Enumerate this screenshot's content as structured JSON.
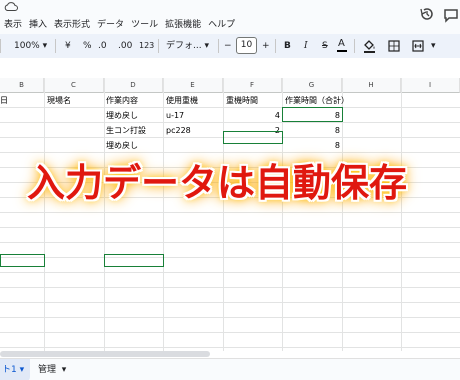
{
  "menu": [
    "表示",
    "挿入",
    "表示形式",
    "データ",
    "ツール",
    "拡張機能",
    "ヘルプ"
  ],
  "toolbar": {
    "zoom": "100%",
    "yen": "¥",
    "percent": "%",
    "dec_less": ".0",
    "dec_more": ".00",
    "num_format": "123",
    "font": "デフォ...",
    "minus": "−",
    "font_size": "10",
    "plus": "+",
    "bold": "B",
    "italic": "I",
    "strike": "S",
    "text_color": "A"
  },
  "columns": [
    "B",
    "C",
    "D",
    "E",
    "F",
    "G",
    "H",
    "I"
  ],
  "sheet": {
    "header_row": {
      "b": "日",
      "c": "現場名",
      "d": "作業内容",
      "e": "使用重機",
      "f": "重機時間",
      "g": "作業時間（合計）"
    },
    "rows": [
      {
        "d": "埋め戻し",
        "e": "u-17",
        "f": "4",
        "g": "8"
      },
      {
        "d": "生コン打設",
        "e": "pc228",
        "f": "2",
        "g": "8"
      },
      {
        "d": "埋め戻し",
        "e": "",
        "f": "",
        "g": "8"
      }
    ]
  },
  "overlay": {
    "headline": "入力データは自動保存"
  },
  "tabs": {
    "active": "ト1",
    "second": "管理"
  },
  "colors": {
    "selection": "#188038",
    "headline": "#e0180f",
    "glow": "#ffb000",
    "accent": "#0b57d0"
  }
}
